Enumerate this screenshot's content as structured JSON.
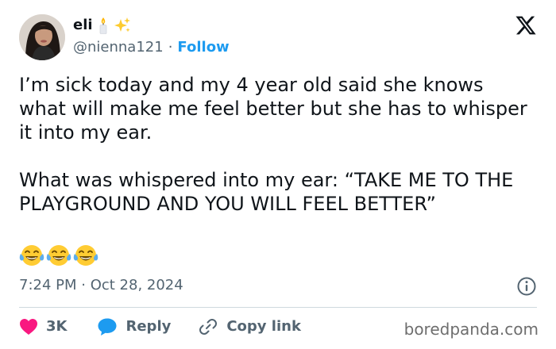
{
  "author": {
    "display_name": "eli",
    "handle": "@nienna121",
    "separator": "·",
    "follow_label": "Follow",
    "emoji_icons": [
      "candle-icon",
      "sparkles-icon"
    ]
  },
  "tweet": {
    "paragraphs": [
      "I’m sick today and my 4 year old said she knows what will make me feel better but she has to whisper it into my ear.",
      "What was whispered into my ear: “TAKE ME TO THE PLAYGROUND AND YOU WILL FEEL BETTER”"
    ],
    "emoji_count": 3,
    "emoji_icon": "tears-of-joy-icon",
    "timestamp": "7:24 PM · Oct 28, 2024"
  },
  "actions": {
    "like_count": "3K",
    "reply_label": "Reply",
    "copy_link_label": "Copy link"
  },
  "watermark": "boredpanda.com",
  "colors": {
    "text": "#0f1419",
    "secondary": "#536471",
    "accent": "#1d9bf0",
    "like": "#f91880",
    "divider": "#cfd9de"
  }
}
